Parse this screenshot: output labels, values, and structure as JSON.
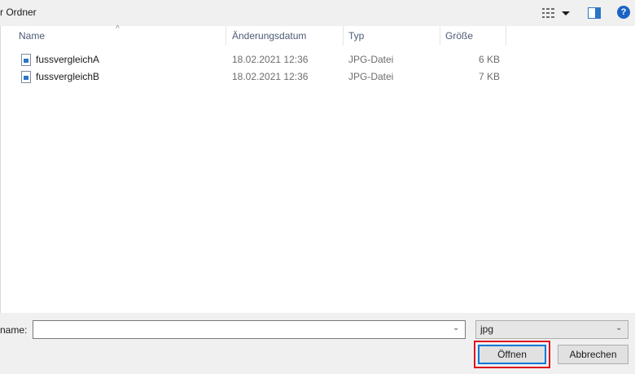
{
  "toolbar": {
    "new_folder_label": "r Ordner",
    "help_label": "?"
  },
  "columns": {
    "name": "Name",
    "date": "Änderungsdatum",
    "type": "Typ",
    "size": "Größe",
    "sort_indicator": "^"
  },
  "files": [
    {
      "name": "fussvergleichA",
      "date": "18.02.2021 12:36",
      "type": "JPG-Datei",
      "size": "6 KB"
    },
    {
      "name": "fussvergleichB",
      "date": "18.02.2021 12:36",
      "type": "JPG-Datei",
      "size": "7 KB"
    }
  ],
  "footer": {
    "filename_label": "name:",
    "filename_value": "",
    "filetype_selected": "jpg",
    "open_label": "Öffnen",
    "cancel_label": "Abbrechen"
  },
  "colors": {
    "accent": "#0078d7",
    "highlight": "#e0141e",
    "header_text": "#4d5b74"
  }
}
